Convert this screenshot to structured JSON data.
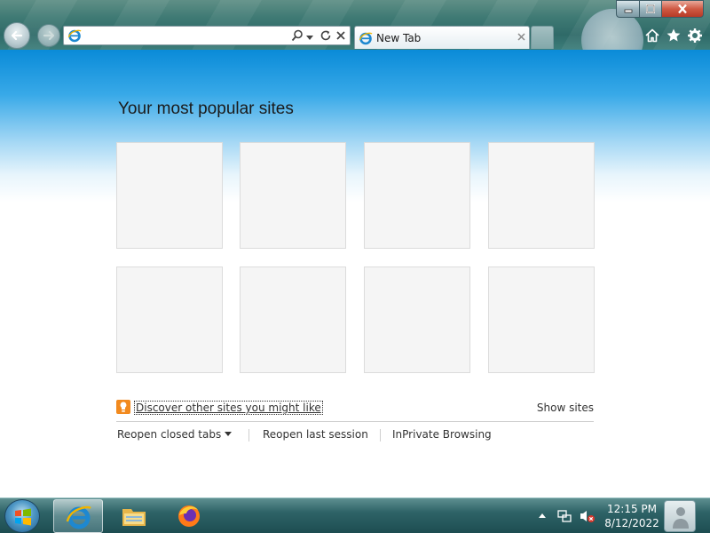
{
  "browser": {
    "address_bar": {
      "value": "",
      "placeholder": ""
    },
    "tab": {
      "label": "New Tab"
    }
  },
  "page": {
    "title": "Your most popular sites",
    "tiles_count": 8,
    "discover_link": "Discover other sites you might like",
    "show_sites": "Show sites",
    "bottom_links": {
      "reopen_closed_tabs": "Reopen closed tabs",
      "reopen_last_session": "Reopen last session",
      "inprivate": "InPrivate Browsing"
    }
  },
  "taskbar": {
    "apps": [
      "internet-explorer",
      "windows-explorer",
      "firefox"
    ],
    "clock": {
      "time": "12:15 PM",
      "date": "8/12/2022"
    }
  },
  "colors": {
    "accent_blue": "#0a8bd8",
    "close_red": "#cf5a44",
    "discover_orange": "#f28a1e"
  }
}
